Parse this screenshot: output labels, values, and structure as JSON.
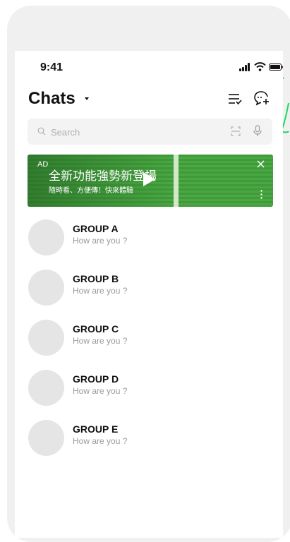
{
  "status_bar": {
    "time": "9:41",
    "icons": [
      "signal-icon",
      "wifi-icon",
      "battery-icon"
    ]
  },
  "header": {
    "title": "Chats",
    "actions": [
      "sort-icon",
      "new-chat-icon"
    ]
  },
  "search": {
    "placeholder": "Search",
    "icons": [
      "search-icon",
      "scan-icon",
      "mic-icon"
    ]
  },
  "ad": {
    "badge": "AD",
    "headline": "全新功能強勢新登場",
    "subline": "隨時看、方便傳！快來體驗",
    "icons": [
      "play-icon",
      "close-icon",
      "more-icon"
    ]
  },
  "chats": [
    {
      "name": "GROUP A",
      "preview": "How are you ?"
    },
    {
      "name": "GROUP B",
      "preview": "How are you ?"
    },
    {
      "name": "GROUP C",
      "preview": "How are you ?"
    },
    {
      "name": "GROUP D",
      "preview": "How are you ?"
    },
    {
      "name": "GROUP E",
      "preview": "How are you ?"
    }
  ],
  "colors": {
    "accent_green": "#1ed760",
    "ad_green": "#4aa742",
    "avatar": "#e5e5e5",
    "screen_bg": "#ffffff",
    "frame_bg": "#f0f0f0"
  }
}
